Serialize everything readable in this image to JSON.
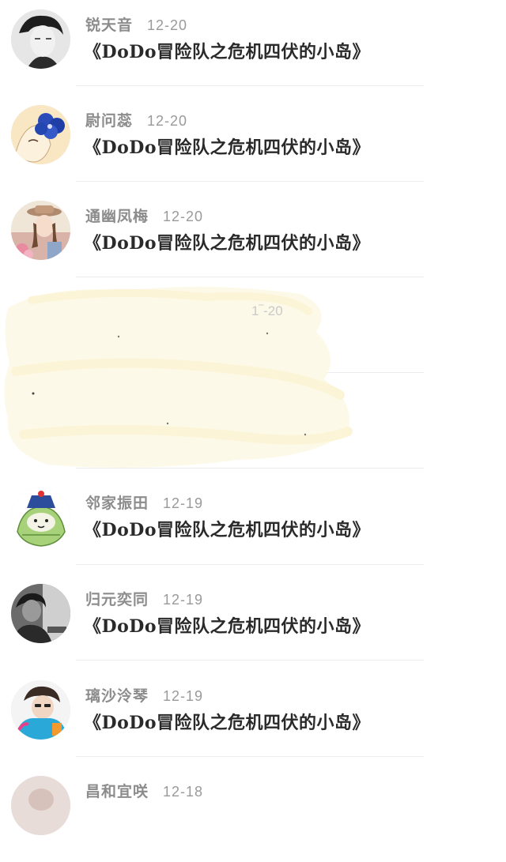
{
  "comments": [
    {
      "name": "锐天音",
      "date": "12-20",
      "text": "《DoDo冒险队之危机四伏的小岛》",
      "avatar_icon": "avatar-bw-boy"
    },
    {
      "name": "尉问蕊",
      "date": "12-20",
      "text": "《DoDo冒险队之危机四伏的小岛》",
      "avatar_icon": "avatar-blue-flower"
    },
    {
      "name": "通幽凤梅",
      "date": "12-20",
      "text": "《DoDo冒险队之危机四伏的小岛》",
      "avatar_icon": "avatar-girl-hat"
    },
    {
      "name": "邻家振田",
      "date": "12-19",
      "text": "《DoDo冒险队之危机四伏的小岛》",
      "avatar_icon": "avatar-cartoon-zongzi"
    },
    {
      "name": "归元奕同",
      "date": "12-19",
      "text": "《DoDo冒险队之危机四伏的小岛》",
      "avatar_icon": "avatar-bw-person"
    },
    {
      "name": "璃沙泠琴",
      "date": "12-19",
      "text": "《DoDo冒险队之危机四伏的小岛》",
      "avatar_icon": "avatar-colorful-boy"
    },
    {
      "name": "昌和宜咲",
      "date": "12-18",
      "text": "",
      "avatar_icon": "avatar-partial"
    }
  ],
  "redacted": {
    "date_fragment": "1‾-20"
  },
  "colors": {
    "name": "#8c8c8c",
    "date": "#9a9a9a",
    "text": "#2a2a2a",
    "divider": "#ececec",
    "smudge": "#fdf9e8"
  }
}
